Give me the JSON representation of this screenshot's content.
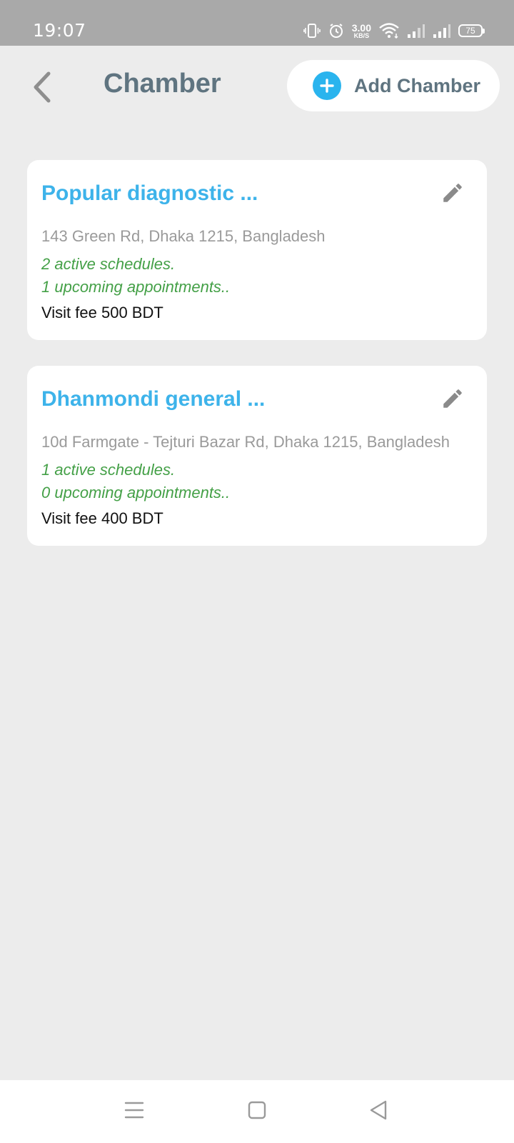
{
  "status_bar": {
    "time": "19:07",
    "net_speed_value": "3.00",
    "net_speed_unit": "KB/S",
    "battery": "75"
  },
  "header": {
    "title": "Chamber",
    "add_label": "Add Chamber"
  },
  "chambers": [
    {
      "name": "Popular diagnostic ...",
      "address": "143 Green Rd, Dhaka 1215, Bangladesh",
      "schedules": "2 active schedules.",
      "appointments": "1 upcoming appointments..",
      "fee": "Visit fee 500 BDT"
    },
    {
      "name": "Dhanmondi general ...",
      "address": "10d Farmgate - Tejturi Bazar Rd, Dhaka 1215, Bangladesh",
      "schedules": "1 active schedules.",
      "appointments": "0 upcoming appointments..",
      "fee": "Visit fee 400 BDT"
    }
  ],
  "colors": {
    "accent": "#3db3ea",
    "title": "#5f7480",
    "active_green": "#44a047",
    "background": "#ececec"
  },
  "icons": {
    "back": "back-arrow-icon",
    "add": "plus-circle-icon",
    "edit": "pencil-icon",
    "nav_menu": "menu-icon",
    "nav_home": "square-home-icon",
    "nav_back": "triangle-back-icon"
  }
}
